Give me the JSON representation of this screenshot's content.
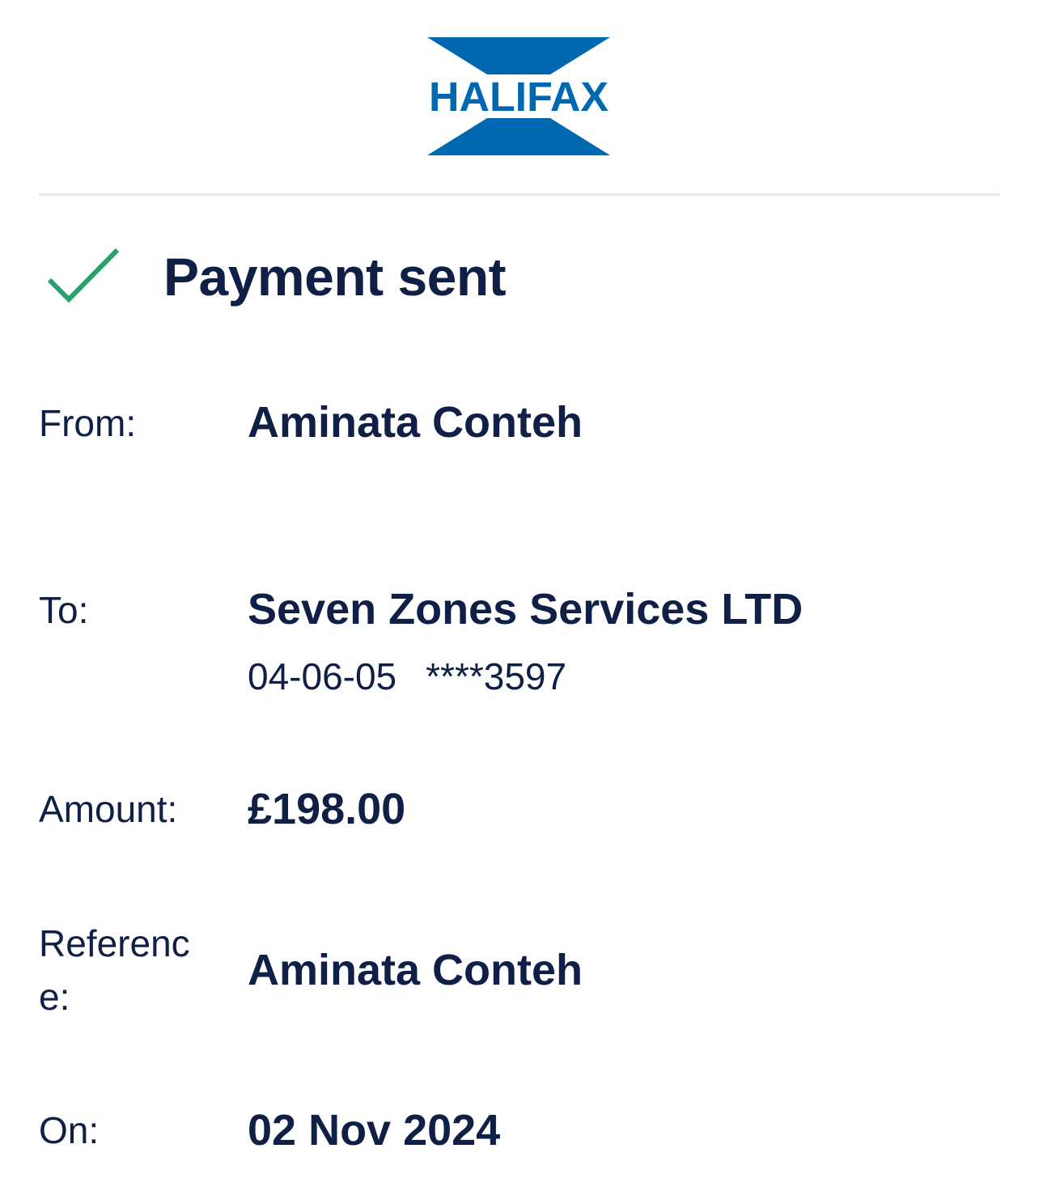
{
  "header": {
    "logo_text": "HALIFAX",
    "logo_icon": "halifax-x-logo",
    "brand_color": "#0068b0"
  },
  "status": {
    "icon": "checkmark-icon",
    "icon_color": "#26a26a",
    "title": "Payment sent"
  },
  "details": {
    "from_label": "From:",
    "from_value": "Aminata Conteh",
    "to_label": "To:",
    "to_value": "Seven Zones Services LTD",
    "to_sort_code": "04-06-05",
    "to_account_masked": "****3597",
    "amount_label": "Amount:",
    "amount_value": "£198.00",
    "reference_label": "Reference:",
    "reference_value": "Aminata Conteh",
    "on_label": "On:",
    "on_value": "02 Nov 2024"
  },
  "colors": {
    "text": "#0f1f45",
    "divider": "#e6e6ec"
  }
}
